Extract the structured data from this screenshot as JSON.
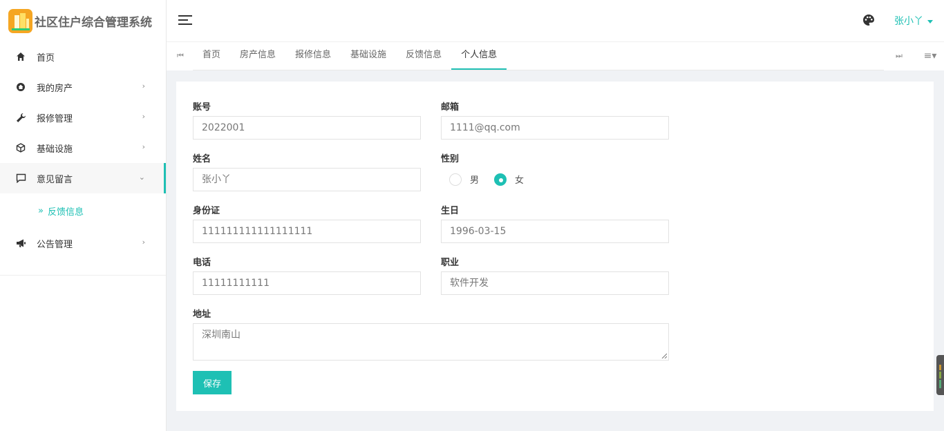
{
  "app": {
    "title": "社区住户综合管理系统"
  },
  "sidebar": {
    "items": [
      {
        "label": "首页",
        "icon": "home-icon"
      },
      {
        "label": "我的房产",
        "icon": "house-icon"
      },
      {
        "label": "报修管理",
        "icon": "wrench-icon"
      },
      {
        "label": "基础设施",
        "icon": "cube-icon"
      },
      {
        "label": "意见留言",
        "icon": "message-icon"
      },
      {
        "label": "公告管理",
        "icon": "megaphone-icon"
      }
    ],
    "sub_items": [
      {
        "label": "反馈信息",
        "prefix": "»"
      }
    ]
  },
  "header": {
    "user_name": "张小丫"
  },
  "tabs": [
    {
      "label": "首页"
    },
    {
      "label": "房产信息"
    },
    {
      "label": "报修信息"
    },
    {
      "label": "基础设施"
    },
    {
      "label": "反馈信息"
    },
    {
      "label": "个人信息"
    }
  ],
  "form": {
    "account": {
      "label": "账号",
      "value": "2022001"
    },
    "email": {
      "label": "邮箱",
      "value": "1111@qq.com"
    },
    "name": {
      "label": "姓名",
      "value": "张小丫"
    },
    "gender": {
      "label": "性别",
      "options": [
        "男",
        "女"
      ],
      "selected": "女"
    },
    "id_card": {
      "label": "身份证",
      "value": "111111111111111111"
    },
    "birthday": {
      "label": "生日",
      "value": "1996-03-15"
    },
    "phone": {
      "label": "电话",
      "value": "11111111111"
    },
    "job": {
      "label": "职业",
      "value": "软件开发"
    },
    "address": {
      "label": "地址",
      "value": "深圳南山"
    },
    "save_label": "保存"
  },
  "colors": {
    "accent": "#1ec0b4",
    "logo": "#f5a623"
  }
}
